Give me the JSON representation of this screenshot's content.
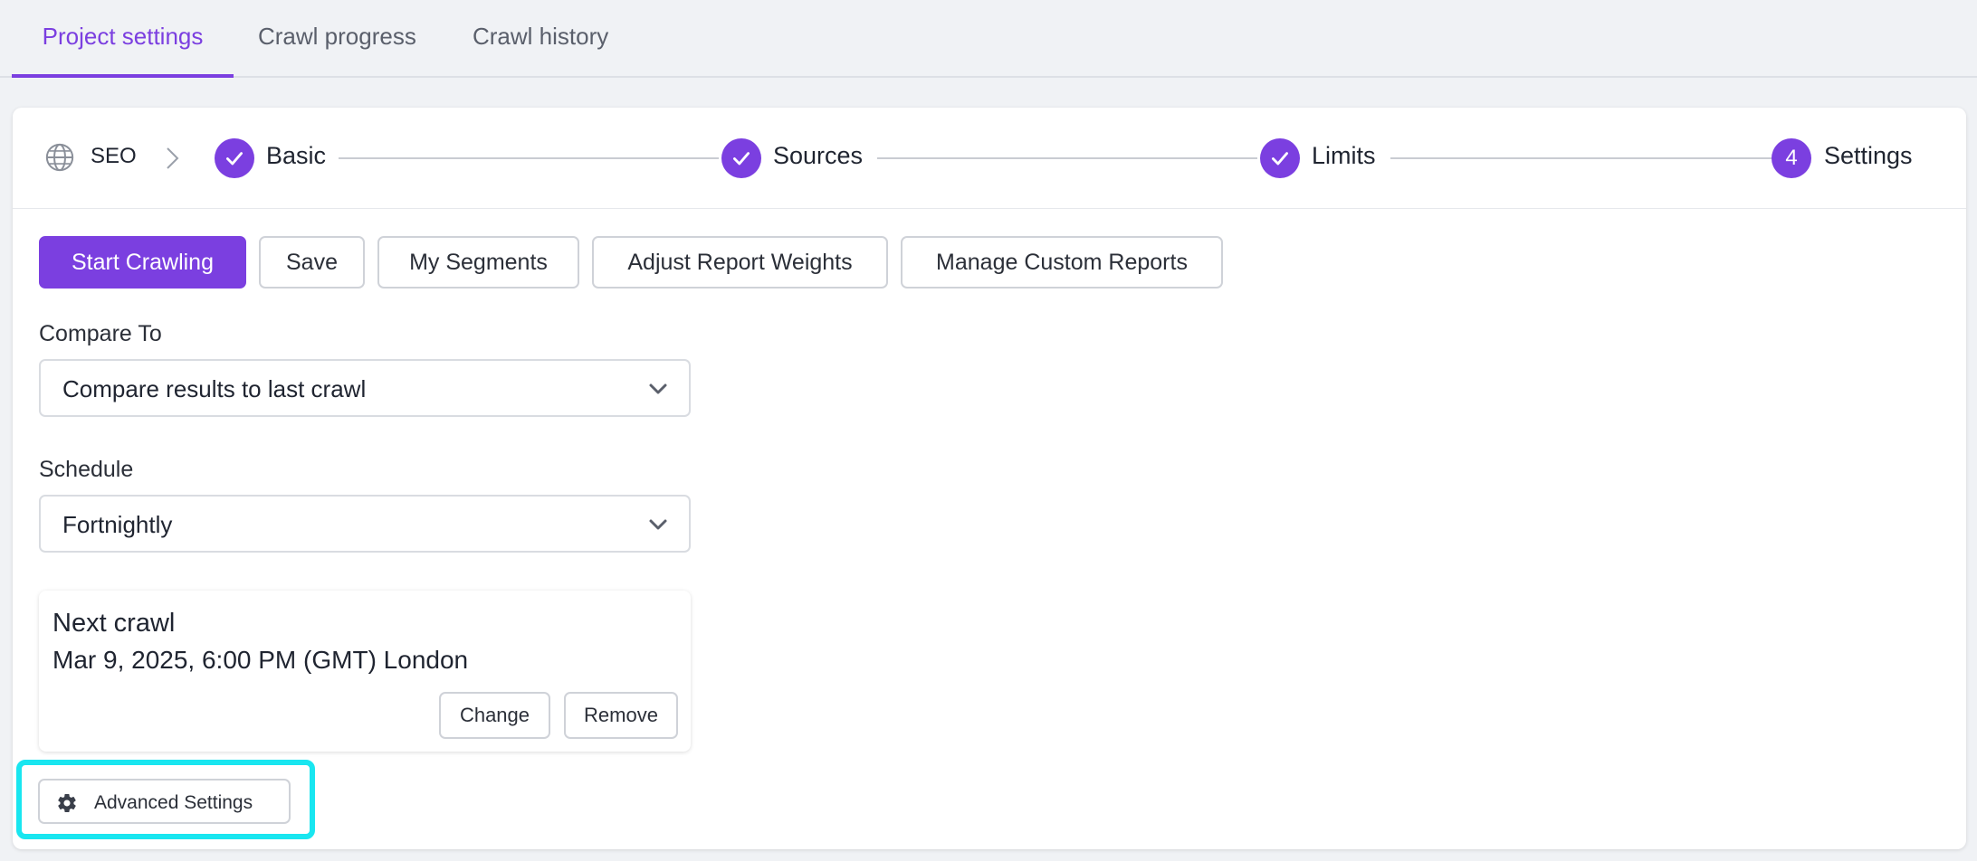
{
  "tabs": [
    {
      "label": "Project settings",
      "active": true
    },
    {
      "label": "Crawl progress",
      "active": false
    },
    {
      "label": "Crawl history",
      "active": false
    }
  ],
  "stepper": {
    "root_label": "SEO",
    "root_icon": "globe-icon",
    "steps": [
      {
        "label": "Basic",
        "status": "complete"
      },
      {
        "label": "Sources",
        "status": "complete"
      },
      {
        "label": "Limits",
        "status": "complete"
      },
      {
        "label": "Settings",
        "status": "current",
        "number": "4"
      }
    ]
  },
  "toolbar": {
    "start_label": "Start Crawling",
    "save_label": "Save",
    "segments_label": "My Segments",
    "weights_label": "Adjust Report Weights",
    "custom_reports_label": "Manage Custom Reports"
  },
  "compare": {
    "label": "Compare To",
    "value": "Compare results to last crawl"
  },
  "schedule": {
    "label": "Schedule",
    "value": "Fortnightly"
  },
  "next_crawl": {
    "title": "Next crawl",
    "datetime": "Mar 9, 2025, 6:00 PM (GMT) London",
    "change_label": "Change",
    "remove_label": "Remove"
  },
  "advanced": {
    "label": "Advanced Settings",
    "icon": "gear-icon"
  },
  "colors": {
    "accent": "#7b3fe0",
    "highlight": "#19e6f0"
  }
}
